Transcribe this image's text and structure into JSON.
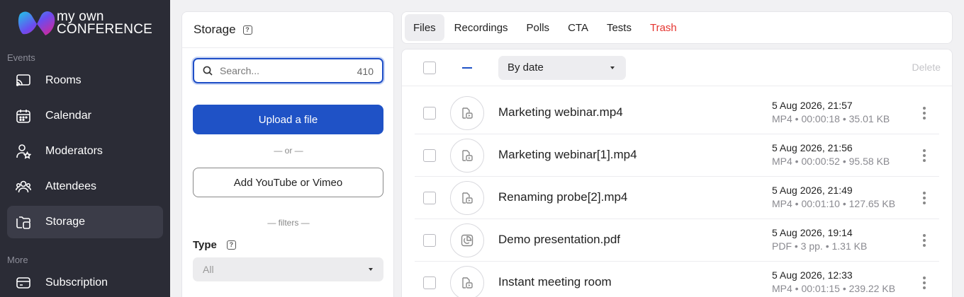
{
  "brand": {
    "line1": "my own",
    "line2": "CONFERENCE"
  },
  "sidebar": {
    "sections": [
      {
        "title": "Events"
      },
      {
        "title": "More"
      }
    ],
    "items": [
      {
        "label": "Rooms",
        "icon": "cast-icon"
      },
      {
        "label": "Calendar",
        "icon": "calendar-icon"
      },
      {
        "label": "Moderators",
        "icon": "moderator-icon"
      },
      {
        "label": "Attendees",
        "icon": "attendees-icon"
      },
      {
        "label": "Storage",
        "icon": "folder-icon",
        "active": true
      },
      {
        "label": "Subscription",
        "icon": "card-icon"
      }
    ]
  },
  "storage": {
    "title": "Storage",
    "search": {
      "placeholder": "Search...",
      "value": "",
      "count": "410"
    },
    "upload_label": "Upload a file",
    "or_label": "— or —",
    "youtube_label": "Add YouTube or Vimeo",
    "filters_label": "— filters —",
    "type_label": "Type",
    "type_value": "All"
  },
  "tabs": [
    {
      "label": "Files",
      "active": true
    },
    {
      "label": "Recordings"
    },
    {
      "label": "Polls"
    },
    {
      "label": "CTA"
    },
    {
      "label": "Tests"
    },
    {
      "label": "Trash"
    }
  ],
  "toolbar": {
    "sort_value": "By date",
    "select_all_indicator": "—",
    "delete_label": "Delete"
  },
  "files": [
    {
      "name": "Marketing webinar.mp4",
      "date": "5 Aug 2026, 21:57",
      "meta": "MP4 • 00:00:18 • 35.01 KB",
      "kind": "video-file-icon"
    },
    {
      "name": "Marketing webinar[1].mp4",
      "date": "5 Aug 2026, 21:56",
      "meta": "MP4 • 00:00:52 • 95.58 KB",
      "kind": "video-file-icon"
    },
    {
      "name": "Renaming probe[2].mp4",
      "date": "5 Aug 2026, 21:49",
      "meta": "MP4 • 00:01:10 • 127.65 KB",
      "kind": "video-file-icon"
    },
    {
      "name": "Demo presentation.pdf",
      "date": "5 Aug 2026, 19:14",
      "meta": "PDF • 3 pp. • 1.31 KB",
      "kind": "presentation-file-icon"
    },
    {
      "name": "Instant meeting room",
      "date": "5 Aug 2026, 12:33",
      "meta": "MP4 • 00:01:15 • 239.22 KB",
      "kind": "video-file-icon"
    }
  ],
  "colors": {
    "sidebar_bg": "#2b2c36",
    "accent": "#1f52c6",
    "trash": "#e5342f"
  }
}
